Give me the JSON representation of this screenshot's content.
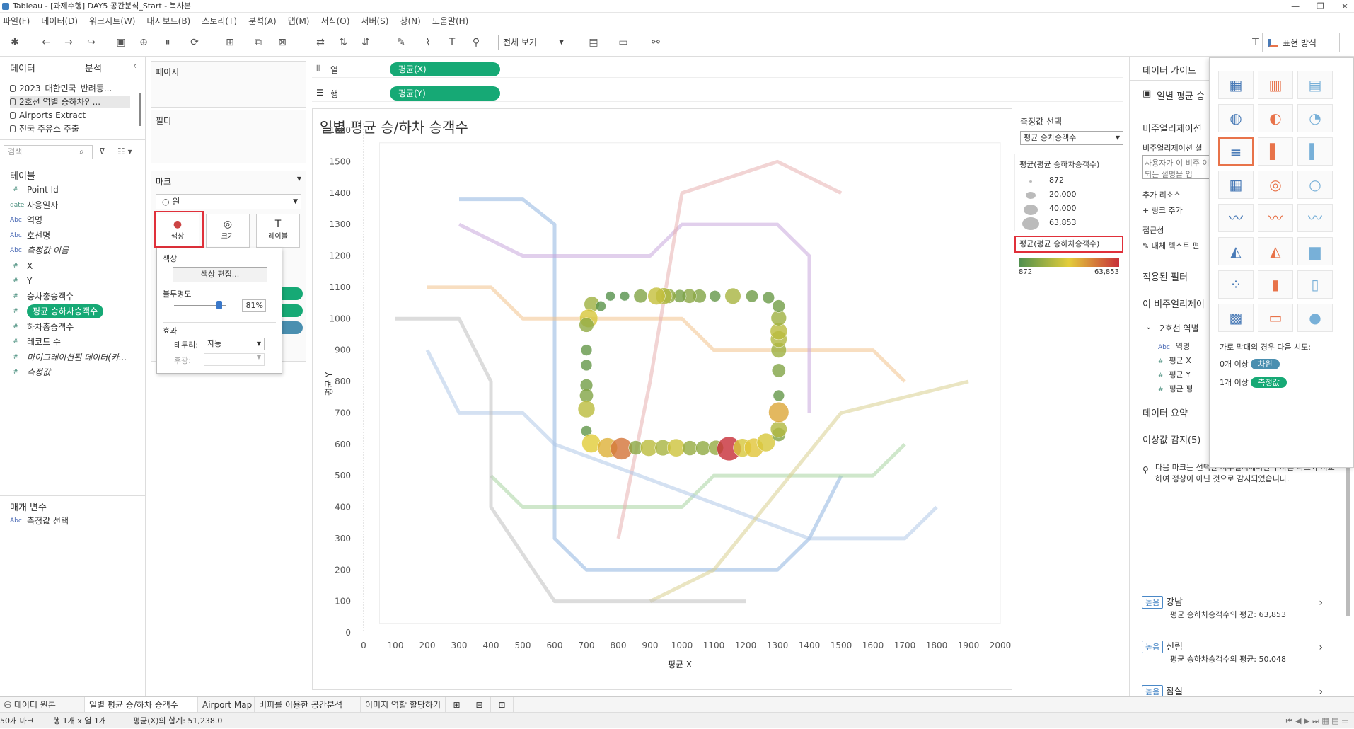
{
  "window": {
    "title": "Tableau - [과제수행] DAY5 공간분석_Start - 복사본"
  },
  "menu": [
    "파일(F)",
    "데이터(D)",
    "워크시트(W)",
    "대시보드(B)",
    "스토리(T)",
    "분석(A)",
    "맵(M)",
    "서식(O)",
    "서버(S)",
    "창(N)",
    "도움말(H)"
  ],
  "toolbar": {
    "view_select": "전체 보기",
    "show_me_label": "표현 방식"
  },
  "left_panel": {
    "tab_data": "데이터",
    "tab_analysis": "분석",
    "data_sources": [
      "2023_대한민국_반려동...",
      "2호선 역별 승하차인...",
      "Airports Extract",
      "전국 주유소 추출"
    ],
    "search_placeholder": "검색",
    "tables_header": "테이블",
    "fields": [
      {
        "type": "#",
        "name": "Point Id"
      },
      {
        "type": "date",
        "name": "사용일자"
      },
      {
        "type": "Abc",
        "name": "역명"
      },
      {
        "type": "Abc",
        "name": "호선명"
      },
      {
        "type": "Abc",
        "name": "측정값 이름"
      },
      {
        "type": "#",
        "name": "X"
      },
      {
        "type": "#",
        "name": "Y"
      },
      {
        "type": "#",
        "name": "승차총승객수"
      },
      {
        "type": "#",
        "name": "평균 승하차승객수"
      },
      {
        "type": "#",
        "name": "하차총승객수"
      },
      {
        "type": "#",
        "name": "레코드 수"
      },
      {
        "type": "#",
        "name": "마이그레이션된 데이터(카..."
      },
      {
        "type": "#",
        "name": "측정값"
      }
    ],
    "params_header": "매개 변수",
    "params": [
      {
        "type": "Abc",
        "name": "측정값 선택"
      }
    ]
  },
  "cards": {
    "pages": "페이지",
    "filters": "필터",
    "marks": "마크",
    "mark_type": "원",
    "mark_buttons": [
      "색상",
      "크기",
      "레이블"
    ],
    "columns_label": "열",
    "rows_label": "행",
    "columns_pill": "평균(X)",
    "rows_pill": "평균(Y)"
  },
  "color_popup": {
    "title": "색상",
    "edit_button": "색상 편집...",
    "opacity_label": "불투명도",
    "opacity_value": "81%",
    "opacity_fraction": 0.81,
    "effects_label": "효과",
    "border_label": "테두리:",
    "border_value": "자동",
    "halo_label": "후광:"
  },
  "viz": {
    "title": "일별 평균 승/하차 승객수"
  },
  "legend": {
    "param_title": "측정값 선택",
    "param_value": "평균 승차승객수",
    "size_title": "평균(평균 승하차승객수)",
    "size_items": [
      "872",
      "20,000",
      "40,000",
      "63,853"
    ],
    "color_title": "평균(평균 승하차승객수)",
    "color_min": "872",
    "color_max": "63,853",
    "colors": {
      "low": "#4e8f4e",
      "mid": "#e3cd3a",
      "high": "#c8303a"
    }
  },
  "right_panel": {
    "data_guide": "데이터 가이드",
    "sheet_name": "일별 평균 승",
    "viz_header": "비주얼리제이션",
    "viz_desc_label": "비주얼리제이션 설",
    "viz_desc_placeholder": "사용자가 이 비주 이 되는 설명을 입",
    "extra_resources": "추가 리소스",
    "add_link": "링크 추가",
    "accessibility": "접근성",
    "alt_text": "대체 텍스트 편",
    "applied_filters": "적용된 필터",
    "this_viz": "이 비주얼리제이",
    "source_ref": "2호선 역별",
    "source_fields": [
      {
        "type": "Abc",
        "name": "역명"
      },
      {
        "type": "#",
        "name": "평균 X"
      },
      {
        "type": "#",
        "name": "평균 Y"
      },
      {
        "type": "#",
        "name": "평균 평"
      }
    ],
    "data_summary": "데이터 요약",
    "outliers_header": "이상값 감지(5)",
    "outliers_desc": "다음 마크는 선택한 비주얼리제이션의 다른 마크와 비교하여 정상이 아닌 것으로 감지되었습니다.",
    "outliers": [
      {
        "badge": "높음",
        "name": "강남",
        "desc": "평균 승하차승객수의 평균: 63,853"
      },
      {
        "badge": "높음",
        "name": "신림",
        "desc": "평균 승하차승객수의 평균: 50,048"
      },
      {
        "badge": "높음",
        "name": "잠실",
        "desc": ""
      }
    ]
  },
  "show_me": {
    "hint": "가로 막대의 경우 다음 시도:",
    "req1_prefix": "0개 이상",
    "req1_pill": "차원",
    "req2_prefix": "1개 이상",
    "req2_pill": "측정값"
  },
  "bottom_tabs": [
    "데이터 원본",
    "일별 평균 승/하차 승객수",
    "Airport Map",
    "버퍼를 이용한 공간분석",
    "이미지 역할 할당하기"
  ],
  "status": {
    "marks": "50개 마크",
    "rows_cols": "행 1개 x 열 1개",
    "sum": "평균(X)의 합계: 51,238.0"
  },
  "chart_data": {
    "type": "scatter",
    "title": "일별 평균 승/하차 승객수",
    "xlabel": "평균 X",
    "ylabel": "평균 Y",
    "xlim": [
      0,
      2000
    ],
    "ylim": [
      0,
      1600
    ],
    "x_ticks": [
      0,
      100,
      200,
      300,
      400,
      500,
      600,
      700,
      800,
      900,
      1000,
      1100,
      1200,
      1300,
      1400,
      1500,
      1600,
      1700,
      1800,
      1900,
      2000
    ],
    "y_ticks": [
      0,
      100,
      200,
      300,
      400,
      500,
      600,
      700,
      800,
      900,
      1000,
      1100,
      1200,
      1300,
      1400,
      1500,
      1600
    ],
    "points": [
      {
        "x": 717,
        "y": 1046,
        "v": 18000
      },
      {
        "x": 707,
        "y": 1001,
        "v": 30000
      },
      {
        "x": 700,
        "y": 980,
        "v": 15000
      },
      {
        "x": 700,
        "y": 900,
        "v": 6000
      },
      {
        "x": 700,
        "y": 852,
        "v": 6000
      },
      {
        "x": 700,
        "y": 788,
        "v": 9000
      },
      {
        "x": 700,
        "y": 755,
        "v": 12000
      },
      {
        "x": 700,
        "y": 712,
        "v": 24000
      },
      {
        "x": 700,
        "y": 642,
        "v": 5000
      },
      {
        "x": 715,
        "y": 603,
        "v": 32000
      },
      {
        "x": 766,
        "y": 589,
        "v": 38000
      },
      {
        "x": 810,
        "y": 586,
        "v": 50048
      },
      {
        "x": 855,
        "y": 589,
        "v": 14000
      },
      {
        "x": 896,
        "y": 589,
        "v": 24000
      },
      {
        "x": 940,
        "y": 589,
        "v": 20000
      },
      {
        "x": 982,
        "y": 589,
        "v": 28000
      },
      {
        "x": 1025,
        "y": 588,
        "v": 16000
      },
      {
        "x": 1066,
        "y": 588,
        "v": 15000
      },
      {
        "x": 1107,
        "y": 589,
        "v": 16000
      },
      {
        "x": 1148,
        "y": 586,
        "v": 63853
      },
      {
        "x": 1190,
        "y": 589,
        "v": 30000
      },
      {
        "x": 1226,
        "y": 589,
        "v": 34000
      },
      {
        "x": 1264,
        "y": 606,
        "v": 30000
      },
      {
        "x": 1304,
        "y": 631,
        "v": 12000
      },
      {
        "x": 1304,
        "y": 648,
        "v": 22000
      },
      {
        "x": 1304,
        "y": 702,
        "v": 40000
      },
      {
        "x": 1304,
        "y": 755,
        "v": 6000
      },
      {
        "x": 1304,
        "y": 835,
        "v": 12000
      },
      {
        "x": 1304,
        "y": 900,
        "v": 18000
      },
      {
        "x": 1304,
        "y": 935,
        "v": 22000
      },
      {
        "x": 1304,
        "y": 960,
        "v": 24000
      },
      {
        "x": 1304,
        "y": 1002,
        "v": 18000
      },
      {
        "x": 1304,
        "y": 1040,
        "v": 9000
      },
      {
        "x": 1272,
        "y": 1067,
        "v": 7000
      },
      {
        "x": 1220,
        "y": 1072,
        "v": 8000
      },
      {
        "x": 1160,
        "y": 1072,
        "v": 20000
      },
      {
        "x": 1104,
        "y": 1072,
        "v": 6000
      },
      {
        "x": 1055,
        "y": 1072,
        "v": 12000
      },
      {
        "x": 1023,
        "y": 1072,
        "v": 14000
      },
      {
        "x": 993,
        "y": 1072,
        "v": 10000
      },
      {
        "x": 958,
        "y": 1072,
        "v": 15000
      },
      {
        "x": 943,
        "y": 1072,
        "v": 22000
      },
      {
        "x": 920,
        "y": 1072,
        "v": 26000
      },
      {
        "x": 870,
        "y": 1072,
        "v": 12000
      },
      {
        "x": 820,
        "y": 1072,
        "v": 3000
      },
      {
        "x": 775,
        "y": 1072,
        "v": 3000
      },
      {
        "x": 745,
        "y": 1040,
        "v": 4000
      }
    ]
  }
}
